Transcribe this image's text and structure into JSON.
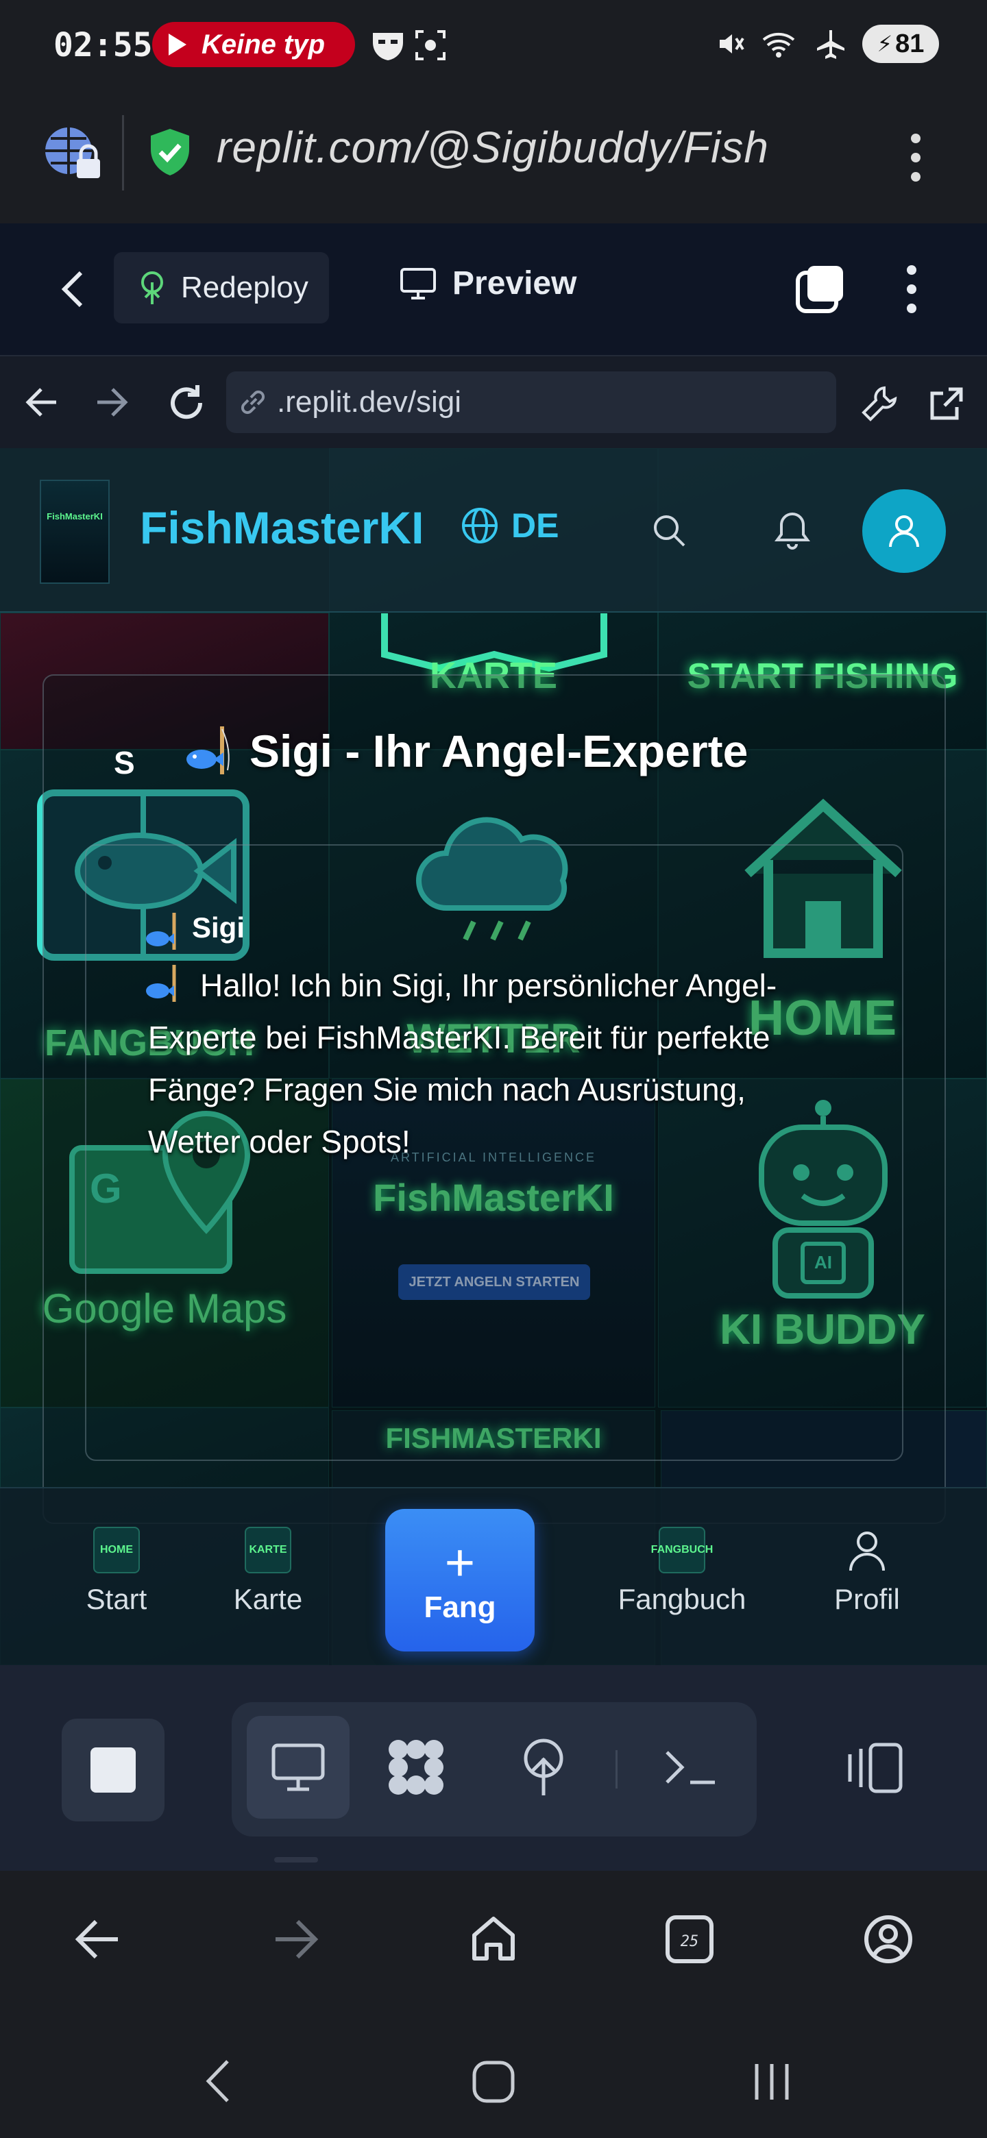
{
  "status_bar": {
    "time": "02:55",
    "media_pill": "Keine typ",
    "battery": "81"
  },
  "browser": {
    "url": "replit.com/@Sigibuddy/Fish"
  },
  "replit": {
    "redeploy_label": "Redeploy",
    "preview_label": "Preview"
  },
  "webview_nav": {
    "address": ".replit.dev/sigi"
  },
  "app": {
    "brand": "FishMasterKI",
    "logo_text": "FishMasterKI",
    "language": "DE",
    "tiles": {
      "karte": "KARTE",
      "start_fishing": "START FISHING",
      "fangbuch": "FANGBUCH",
      "wetter": "WETTER",
      "home": "HOME",
      "google_maps": "Google Maps",
      "center_subtitle": "ARTIFICIAL INTELLIGENCE",
      "center_title": "FishMasterKI",
      "center_button": "JETZT ANGELN STARTEN",
      "ki_buddy": "KI BUDDY",
      "ai_chip": "AI",
      "fishmasterki_bottom": "FISHMASTERKI"
    },
    "chat": {
      "initial": "S",
      "title": "Sigi - Ihr Angel-Experte",
      "sender": "Sigi",
      "message": "Hallo! Ich bin Sigi, Ihr persönlicher Angel-Experte bei FishMasterKI. Bereit für perfekte Fänge? Fragen Sie mich nach Ausrüstung, Wetter oder Spots!"
    },
    "bottom_nav": [
      {
        "label": "Start",
        "thumb": "HOME"
      },
      {
        "label": "Karte",
        "thumb": "KARTE"
      },
      {
        "label": "Fang",
        "icon": "+"
      },
      {
        "label": "Fangbuch",
        "thumb": "FANGBUCH"
      },
      {
        "label": "Profil"
      }
    ]
  },
  "colors": {
    "brand": "#38c8f0",
    "neon_green": "#5df58e",
    "fang_button": "#2563eb",
    "replit_bg": "#0e1525"
  }
}
